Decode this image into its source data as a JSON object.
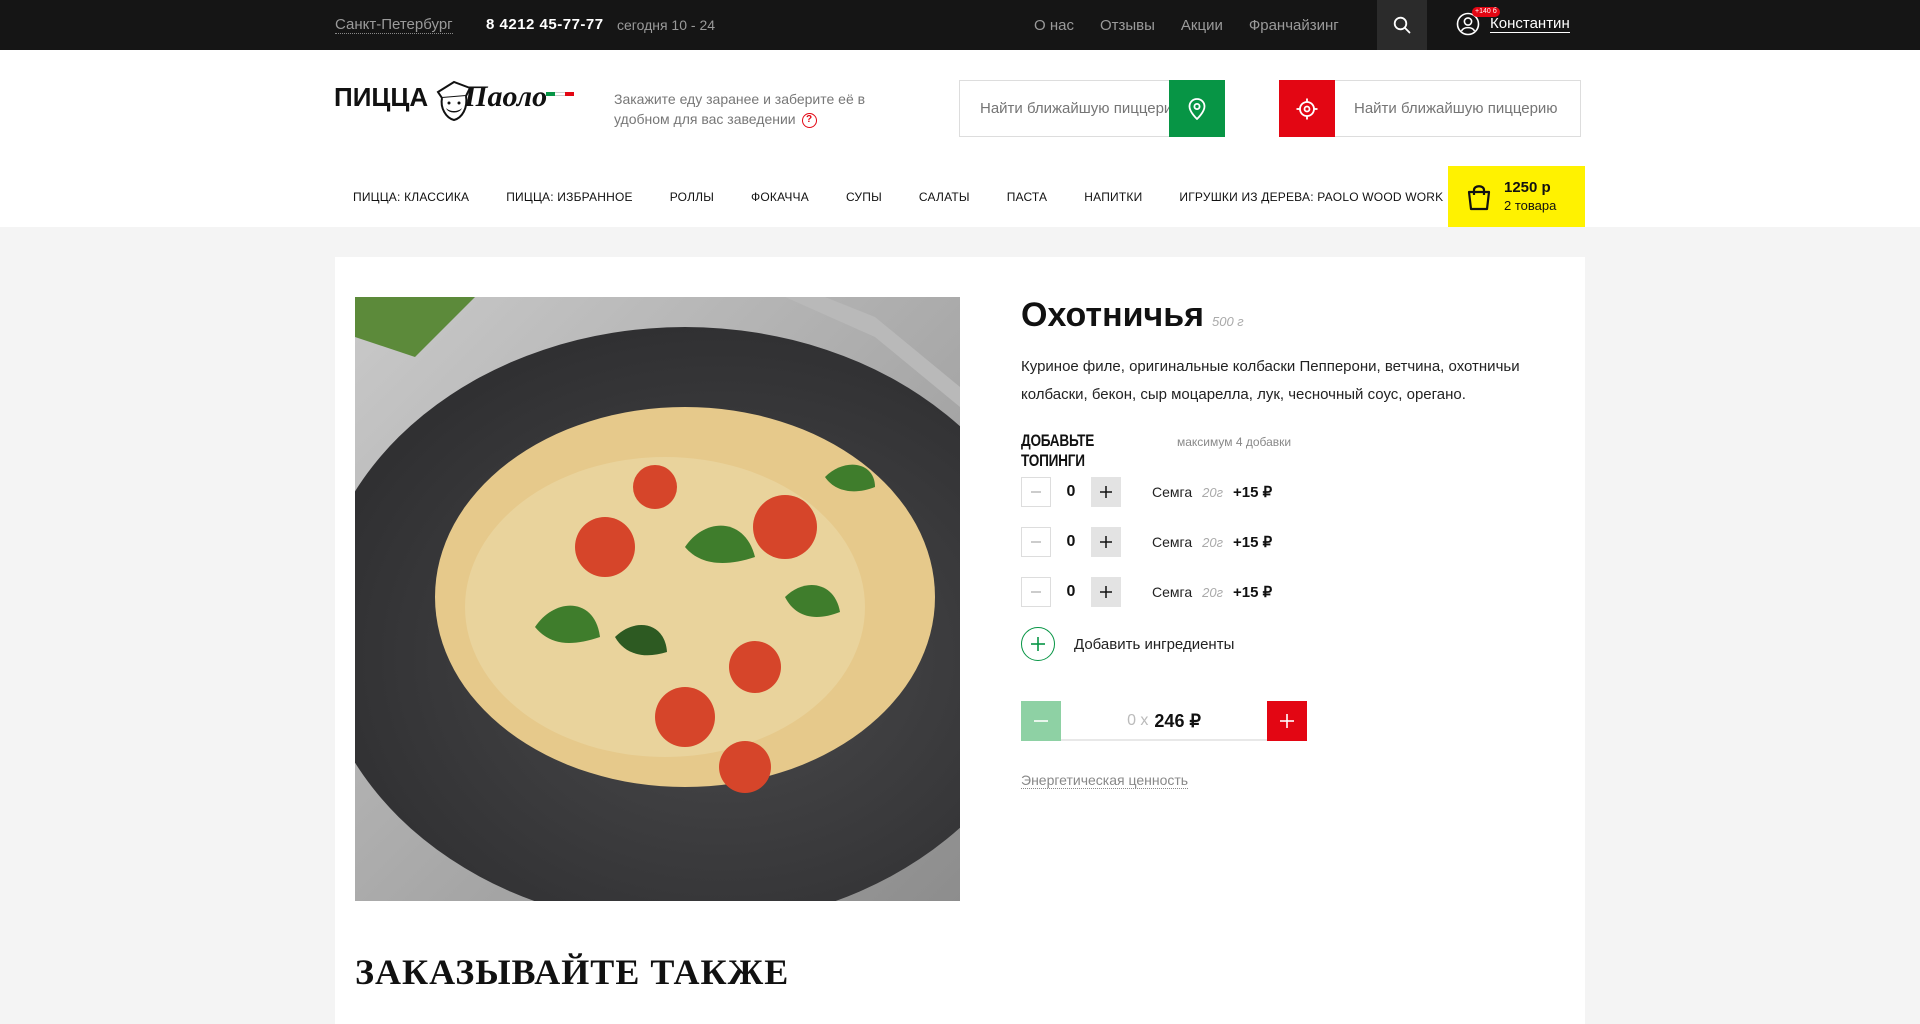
{
  "topbar": {
    "city": "Санкт-Петербург",
    "phone": "8 4212 45-77-77",
    "hours": "сегодня 10 - 24",
    "links": [
      "О нас",
      "Отзывы",
      "Акции",
      "Франчайзинг"
    ],
    "bonus_badge": "+140 б",
    "user_name": "Константин"
  },
  "header": {
    "logo_word1": "ПИЦЦА",
    "logo_word2": "Паоло",
    "tagline": "Закажите еду заранее и заберите её в удобном для вас заведении",
    "help_glyph": "?",
    "finder1_placeholder": "Найти ближайшую пиццерию",
    "finder2_placeholder": "Найти ближайшую пиццерию",
    "nav": [
      "Пицца: классика",
      "Пицца: избранное",
      "Роллы",
      "Фокачча",
      "Супы",
      "Салаты",
      "Паста",
      "Напитки",
      "Игрушки из дерева: Paolo wood work"
    ],
    "cart": {
      "sum": "1250 р",
      "count": "2 товара"
    }
  },
  "product": {
    "name": "Охотничья",
    "weight": "500 г",
    "description": "Куриное филе, оригинальные колбаски Пепперони, ветчина, охотничьи колбаски, бекон, сыр моцарелла, лук, чесночный соус, орегано.",
    "toppings_title": "Добавьте топинги",
    "toppings_max": "максимум 4 добавки",
    "toppings": [
      {
        "qty": "0",
        "name": "Семга",
        "weight": "20г",
        "price": "+15 ₽"
      },
      {
        "qty": "0",
        "name": "Семга",
        "weight": "20г",
        "price": "+15 ₽"
      },
      {
        "qty": "0",
        "name": "Семга",
        "weight": "20г",
        "price": "+15 ₽"
      }
    ],
    "add_ingredients": "Добавить ингредиенты",
    "order_count": "0 x",
    "price": "246 ₽",
    "energy_link": "Энергетическая ценность"
  },
  "also_title": "ЗАКАЗЫВАЙТЕ ТАКЖЕ",
  "colors": {
    "brand_red": "#e30613",
    "brand_green": "#079545",
    "cart_yellow": "#fff200",
    "topbar_bg": "#151515"
  }
}
